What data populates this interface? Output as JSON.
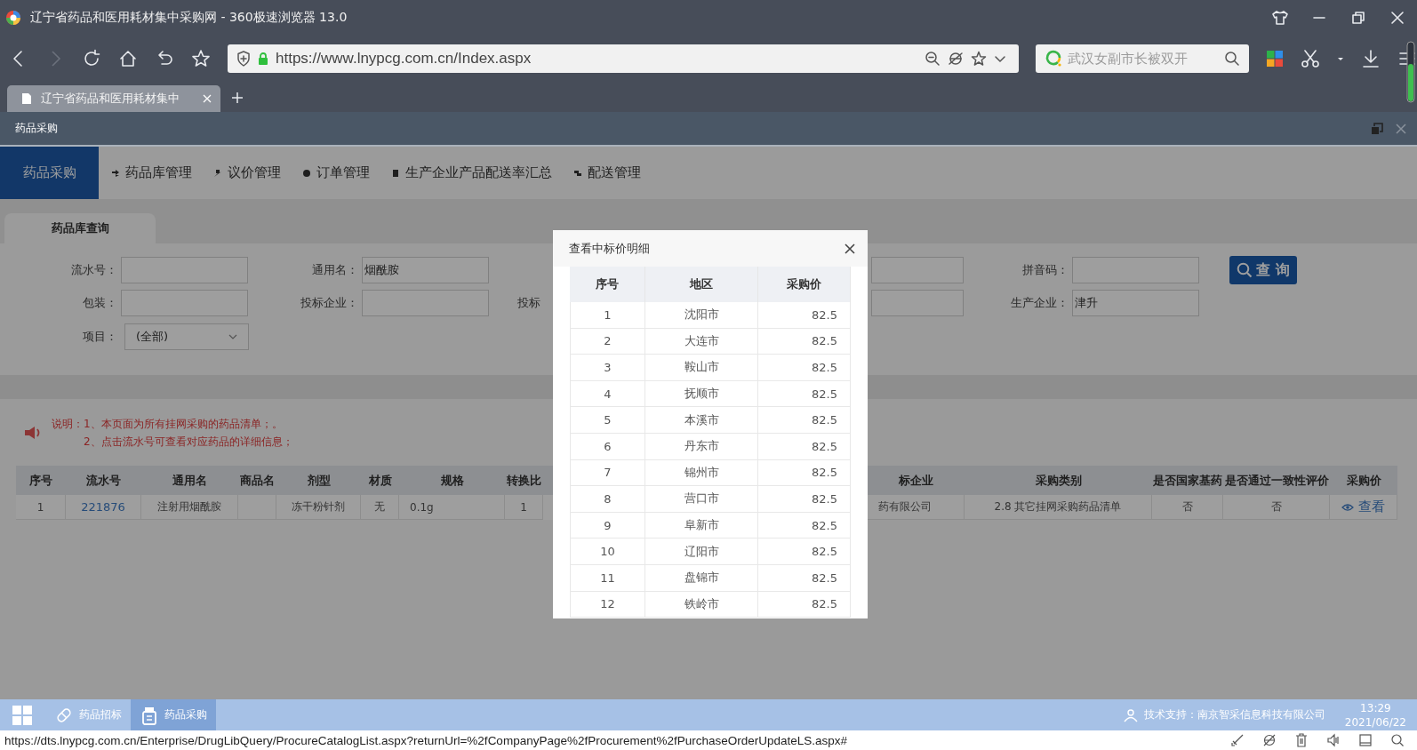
{
  "browser": {
    "title": "辽宁省药品和医用耗材集中采购网 - 360极速浏览器 13.0",
    "url": "https://www.lnypcg.com.cn/Index.aspx",
    "search_placeholder": "武汉女副市长被双开",
    "tabs": [
      {
        "label": "辽宁省药品和医用耗材集中",
        "selected": true
      }
    ]
  },
  "page_header": {
    "title": "药品采购"
  },
  "nav": {
    "brand": "药品采购",
    "items": [
      {
        "label": "药品库管理"
      },
      {
        "label": "议价管理"
      },
      {
        "label": "订单管理"
      },
      {
        "label": "生产企业产品配送率汇总"
      },
      {
        "label": "配送管理"
      }
    ]
  },
  "section_tab": {
    "label": "药品库查询",
    "selected": true
  },
  "form": {
    "rows": [
      [
        {
          "kind": "input",
          "label": "流水号："
        },
        {
          "kind": "input",
          "label": "通用名：",
          "value": "烟酰胺"
        },
        {
          "kind": "input"
        },
        {
          "kind": "input",
          "label": "拼音码："
        },
        {
          "kind": "button",
          "label": "查 询"
        }
      ],
      [
        {
          "kind": "input",
          "label": "包装："
        },
        {
          "kind": "input",
          "label": "投标企业："
        },
        {
          "kind": "input",
          "label": "投标"
        },
        {
          "kind": "input",
          "label": "生产企业：",
          "value": "津升"
        }
      ],
      [
        {
          "kind": "select",
          "label": "项目：",
          "value": "(全部)"
        }
      ]
    ]
  },
  "notes": [
    "说明：1、本页面为所有挂网采购的药品清单；。",
    "2、点击流水号可查看对应药品的详细信息；"
  ],
  "table": {
    "columns": [
      {
        "label": "序号",
        "kind": "text"
      },
      {
        "label": "流水号",
        "kind": "link"
      },
      {
        "label": "通用名",
        "kind": "text"
      },
      {
        "label": "商品名",
        "kind": "text"
      },
      {
        "label": "剂型",
        "kind": "text"
      },
      {
        "label": "材质",
        "kind": "text"
      },
      {
        "label": "规格",
        "kind": "left"
      },
      {
        "label": "转换比",
        "kind": "text"
      },
      {
        "label": "标企业",
        "kind": "left"
      },
      {
        "label": "采购类别",
        "kind": "text"
      },
      {
        "label": "是否国家基药",
        "kind": "text"
      },
      {
        "label": "是否通过一致性评价",
        "kind": "text"
      },
      {
        "label": "采购价",
        "kind": "view"
      }
    ],
    "rows": [
      [
        "1",
        "221876",
        "注射用烟酰胺",
        null,
        "冻干粉针剂",
        "无",
        "0.1g",
        "1",
        "药有限公司",
        "2.8 其它挂网采购药品清单",
        "否",
        "否",
        "查看"
      ]
    ]
  },
  "dialog": {
    "title": "查看中标价明细",
    "columns": [
      "序号",
      "地区",
      "采购价"
    ],
    "rows": [
      [
        "1",
        "沈阳市",
        "82.5"
      ],
      [
        "2",
        "大连市",
        "82.5"
      ],
      [
        "3",
        "鞍山市",
        "82.5"
      ],
      [
        "4",
        "抚顺市",
        "82.5"
      ],
      [
        "5",
        "本溪市",
        "82.5"
      ],
      [
        "6",
        "丹东市",
        "82.5"
      ],
      [
        "7",
        "锦州市",
        "82.5"
      ],
      [
        "8",
        "营口市",
        "82.5"
      ],
      [
        "9",
        "阜新市",
        "82.5"
      ],
      [
        "10",
        "辽阳市",
        "82.5"
      ],
      [
        "11",
        "盘锦市",
        "82.5"
      ],
      [
        "12",
        "铁岭市",
        "82.5"
      ]
    ]
  },
  "taskbar": {
    "items": [
      {
        "label": "药品招标",
        "selected": false
      },
      {
        "label": "药品采购",
        "selected": true
      }
    ],
    "support": "技术支持：南京智采信息科技有限公司",
    "time": "13:29",
    "date": "2021/06/22"
  },
  "status_bar": {
    "url": "https://dts.lnypcg.com.cn/Enterprise/DrugLibQuery/ProcureCatalogList.aspx?returnUrl=%2fCompanyPage%2fProcurement%2fPurchaseOrderUpdateLS.aspx#"
  }
}
